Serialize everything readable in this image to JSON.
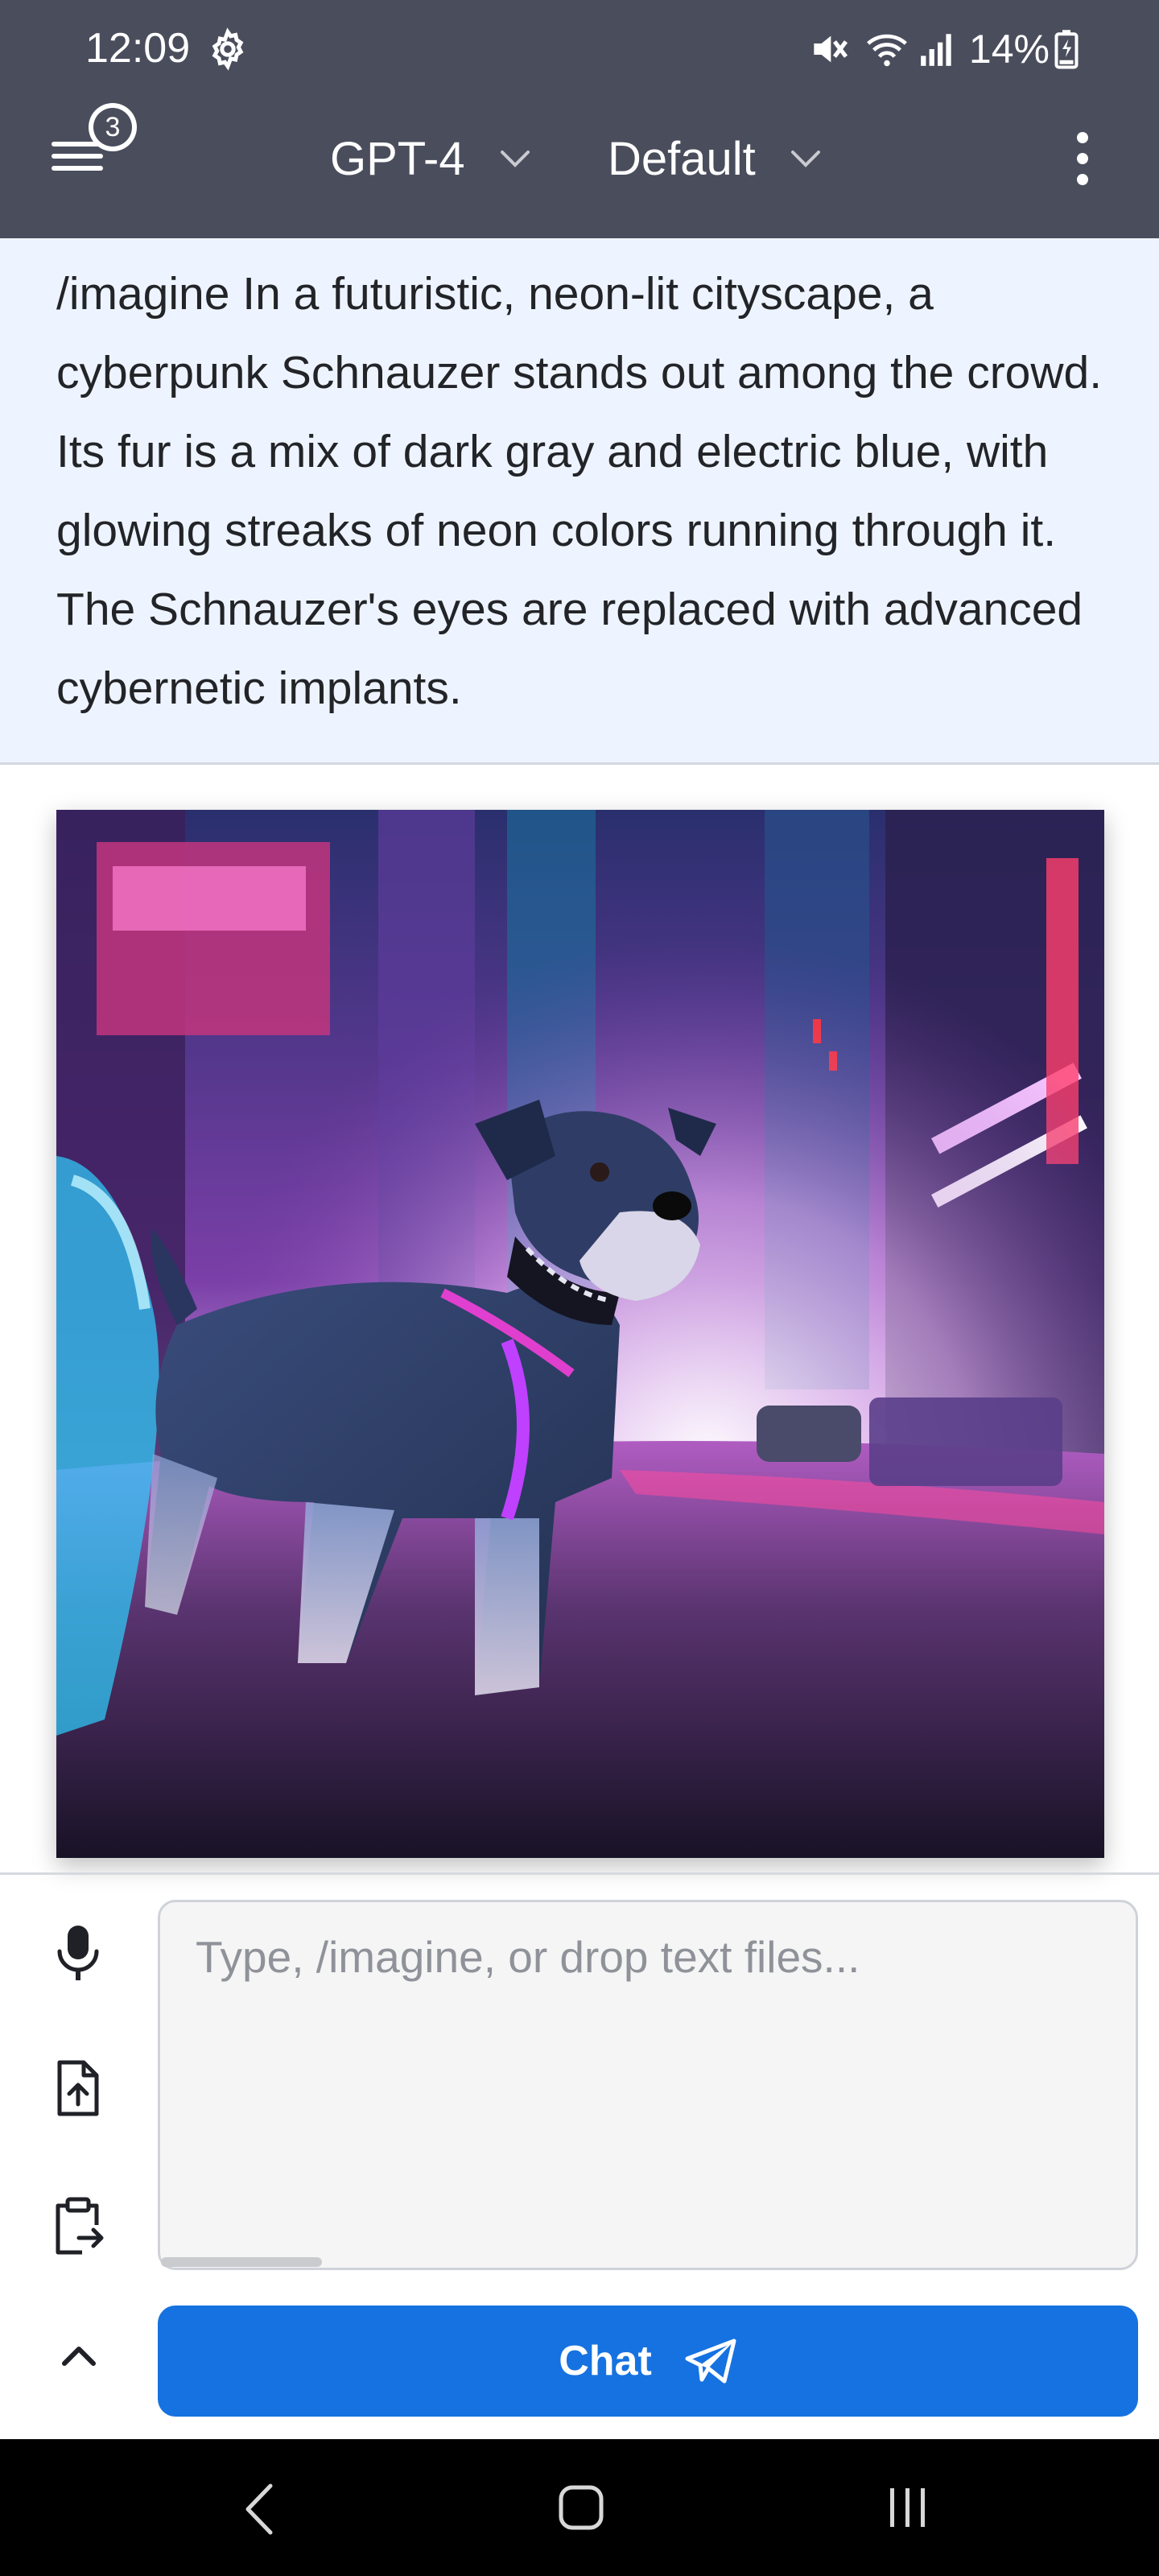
{
  "status_bar": {
    "time": "12:09",
    "battery_percent": "14%"
  },
  "header": {
    "menu_badge_count": "3",
    "model_label": "GPT-4",
    "persona_label": "Default"
  },
  "prompt": {
    "text": "/imagine In a futuristic, neon-lit cityscape, a cyberpunk Schnauzer stands out among the crowd. Its fur is a mix of dark gray and electric blue, with glowing streaks of neon colors running through it. The Schnauzer's eyes are replaced with advanced cybernetic implants."
  },
  "composer": {
    "placeholder": "Type, /imagine, or drop text files...",
    "value": "",
    "chat_label": "Chat"
  },
  "colors": {
    "header_bg": "#4a4d5c",
    "prompt_bg": "#eef4ff",
    "accent": "#1672e0"
  },
  "icons": {
    "status": [
      "settings-gear-icon",
      "mute-icon",
      "wifi-icon",
      "signal-icon",
      "battery-icon"
    ],
    "header": [
      "hamburger-menu-icon",
      "chevron-down-icon",
      "more-vert-icon"
    ],
    "composer": [
      "microphone-icon",
      "file-upload-icon",
      "paste-clipboard-icon",
      "chevron-up-icon",
      "send-plane-icon"
    ],
    "nav": [
      "back-icon",
      "home-icon",
      "recents-icon"
    ]
  }
}
